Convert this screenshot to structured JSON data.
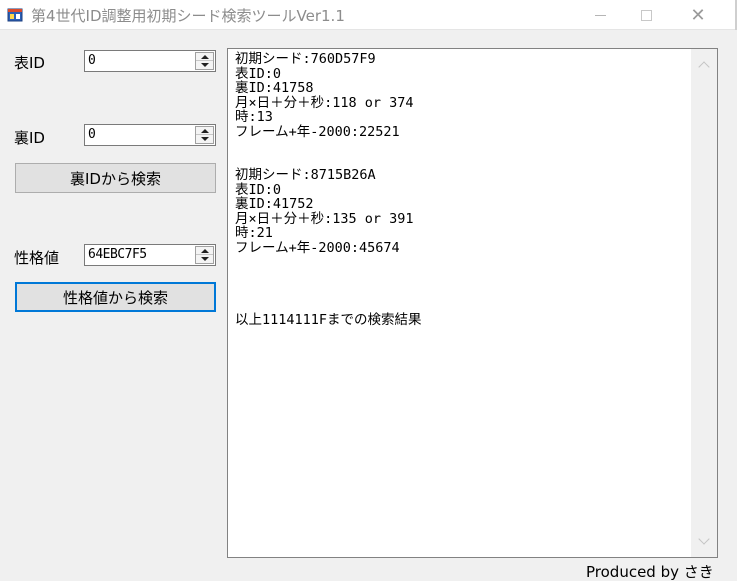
{
  "window": {
    "title": "第4世代ID調整用初期シード検索ツールVer1.1",
    "icon": "app-window-icon",
    "minimize_icon": "minimize-icon",
    "maximize_icon": "maximize-icon",
    "close_icon": "close-icon",
    "close_glyph": "✕"
  },
  "form": {
    "omote_id_label": "表ID",
    "omote_id_value": "0",
    "ura_id_label": "裏ID",
    "ura_id_value": "0",
    "search_by_ura_button": "裏IDから検索",
    "seikaku_label": "性格値",
    "seikaku_value": "64EBC7F5",
    "search_by_seikaku_button": "性格値から検索"
  },
  "output": {
    "text": "初期シード:760D57F9\n表ID:0\n裏ID:41758\n月×日＋分＋秒:118 or 374\n時:13\nフレーム+年-2000:22521\n\n\n初期シード:8715B26A\n表ID:0\n裏ID:41752\n月×日＋分＋秒:135 or 391\n時:21\nフレーム+年-2000:45674\n\n\n\n\n以上1114111Fまでの検索結果"
  },
  "footer": {
    "credit": "Produced by さき"
  },
  "colors": {
    "focus_border": "#0078d7",
    "window_bg": "#f0f0f0"
  }
}
